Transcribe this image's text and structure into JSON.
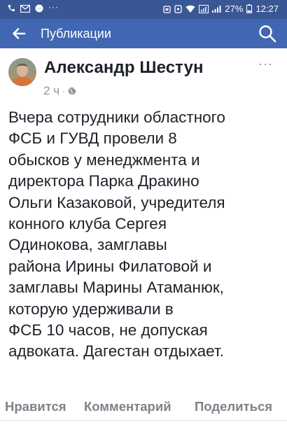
{
  "status_bar": {
    "battery": "27%",
    "time": "12:27"
  },
  "app_bar": {
    "title": "Публикации"
  },
  "post": {
    "author": "Александр Шестун",
    "time": "2 ч",
    "text_lines": [
      "Вчера сотрудники областного",
      "ФСБ и ГУВД провели 8",
      "обысков у менеджмента и",
      "директора Парка Дракино",
      "Ольги Казаковой, учредителя",
      "конного клуба Сергея",
      "Одинокова, замглавы",
      "района Ирины Филатовой и",
      "замглавы Марины Атаманюк,",
      "которую удерживали в",
      "ФСБ 10 часов, не допуская",
      "адвоката. Дагестан отдыхает."
    ]
  },
  "actions": {
    "like": "Нравится",
    "comment": "Комментарий",
    "share": "Поделиться"
  },
  "colors": {
    "status_bar": "#3a5795",
    "app_bar": "#4267b2",
    "text": "#1d2129",
    "muted": "#90949c"
  },
  "icons": [
    "back-arrow-icon",
    "search-icon",
    "more-icon",
    "globe-icon",
    "wifi-icon",
    "signal-icon",
    "battery-icon"
  ]
}
